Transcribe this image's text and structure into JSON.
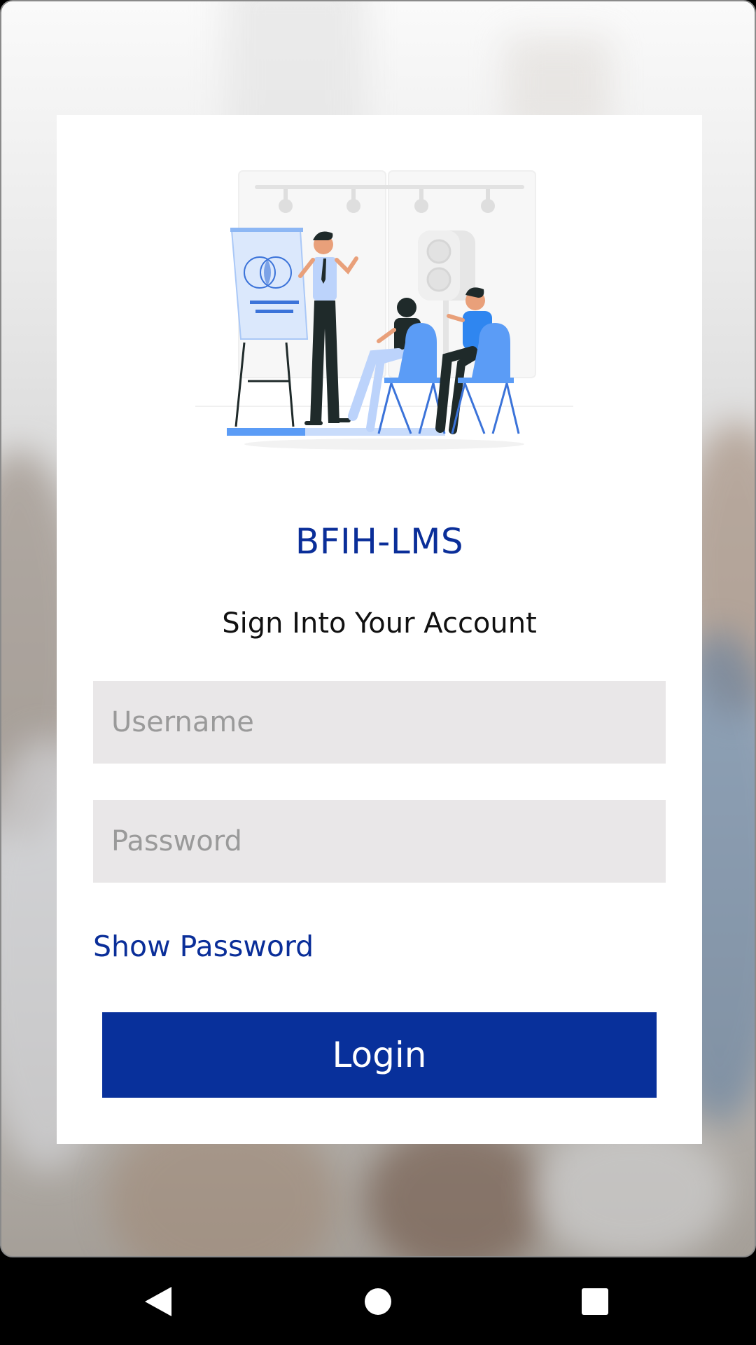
{
  "app": {
    "title": "BFIH-LMS",
    "subtitle": "Sign Into Your Account"
  },
  "form": {
    "username_placeholder": "Username",
    "password_placeholder": "Password",
    "show_password_label": "Show Password",
    "login_label": "Login"
  },
  "colors": {
    "brand": "#08309b",
    "field_bg": "#e9e7e8"
  },
  "nav": {
    "back_icon": "back-triangle-icon",
    "home_icon": "home-circle-icon",
    "recents_icon": "recents-square-icon"
  }
}
